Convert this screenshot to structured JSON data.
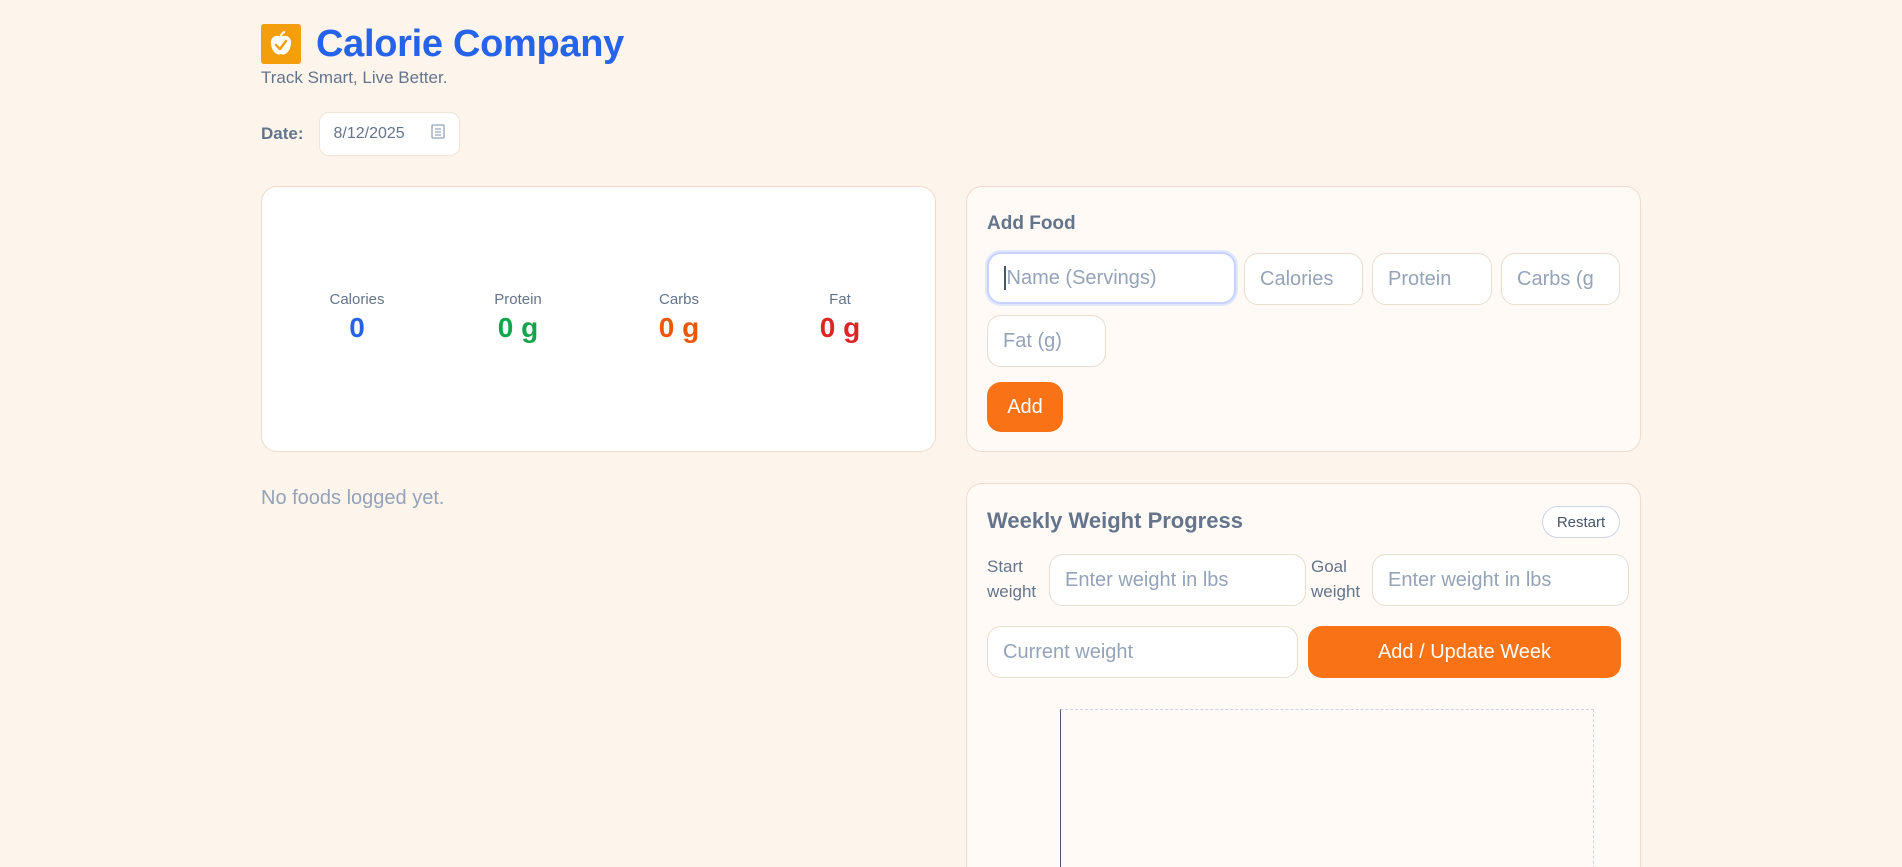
{
  "header": {
    "app_title": "Calorie Company",
    "tagline": "Track Smart, Live Better.",
    "logo_icon": "apple-check-icon",
    "brand_color": "#2563eb",
    "logo_color": "#f59e0b"
  },
  "date": {
    "label": "Date:",
    "value": "8/12/2025",
    "icon": "calendar-icon"
  },
  "summary": {
    "calories": {
      "label": "Calories",
      "value": "0",
      "color": "#2563eb"
    },
    "protein": {
      "label": "Protein",
      "value": "0 g",
      "color": "#16a34a"
    },
    "carbs": {
      "label": "Carbs",
      "value": "0 g",
      "color": "#ea580c"
    },
    "fat": {
      "label": "Fat",
      "value": "0 g",
      "color": "#dc2626"
    }
  },
  "add_food": {
    "title": "Add Food",
    "name_placeholder": "Name (Servings)",
    "calories_placeholder": "Calories",
    "protein_placeholder": "Protein",
    "carbs_placeholder": "Carbs (g",
    "fat_placeholder": "Fat (g)",
    "add_label": "Add"
  },
  "food_log": {
    "empty_message": "No foods logged yet."
  },
  "weight": {
    "title": "Weekly Weight Progress",
    "restart_label": "Restart",
    "start_label_line1": "Start",
    "start_label_line2": "weight",
    "start_placeholder": "Enter weight in lbs",
    "goal_label_line1": "Goal",
    "goal_label_line2": "weight",
    "goal_placeholder": "Enter weight in lbs",
    "current_placeholder": "Current weight",
    "update_label": "Add / Update Week",
    "accent_color": "#f97316"
  }
}
